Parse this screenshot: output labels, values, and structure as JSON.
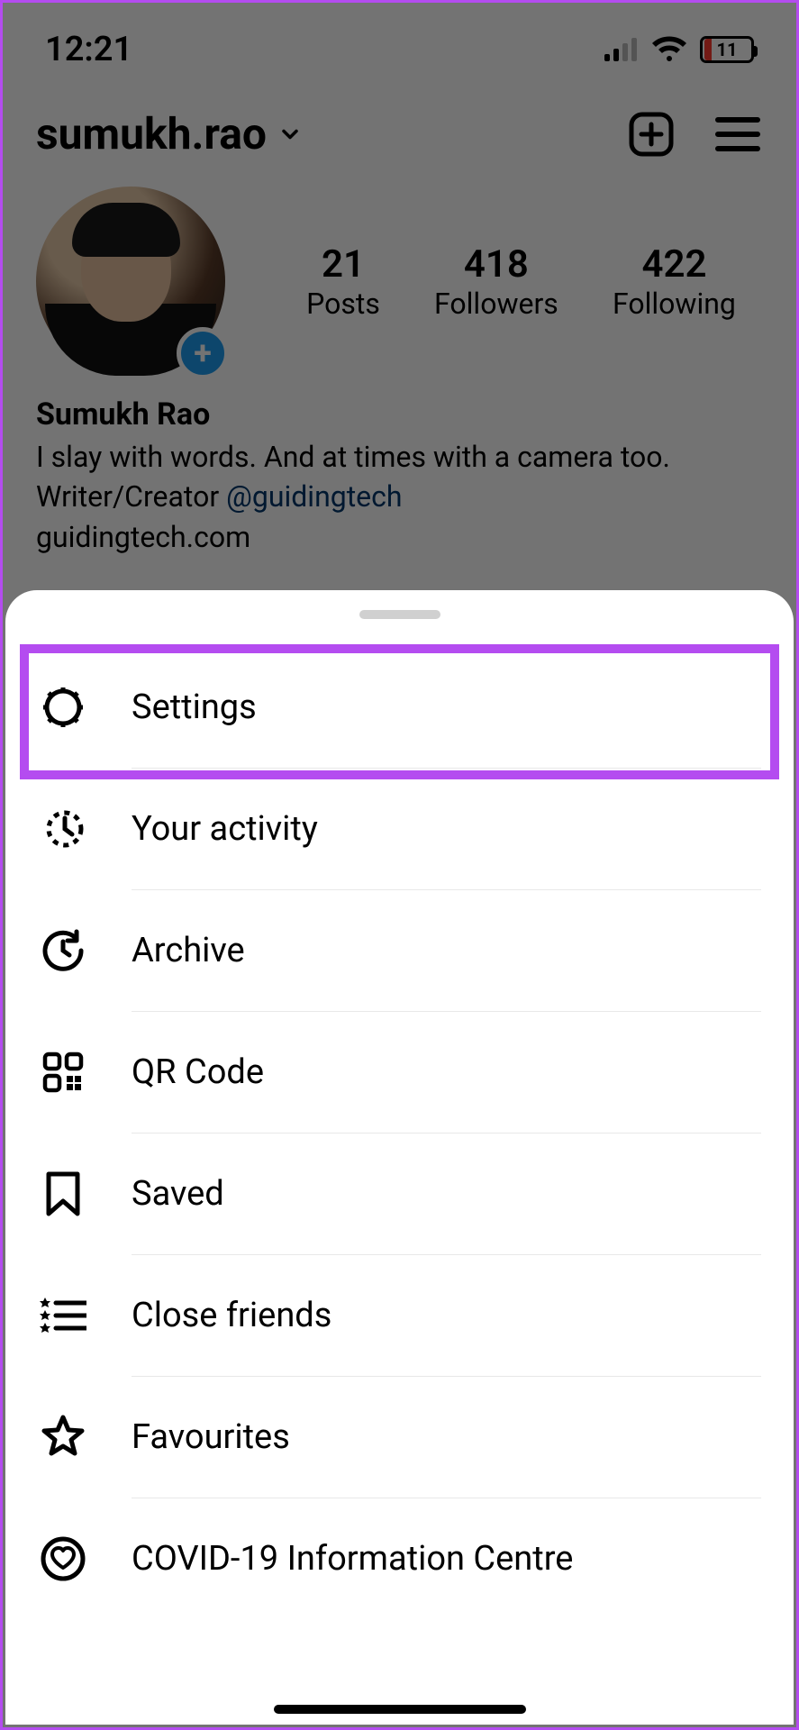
{
  "status": {
    "time": "12:21",
    "battery_pct": "11",
    "battery_low": true
  },
  "profile": {
    "username": "sumukh.rao",
    "display_name": "Sumukh Rao",
    "bio_line1": "I slay with words. And at times with a camera too.",
    "bio_line2_prefix": "Writer/Creator ",
    "bio_line2_handle": "@guidingtech",
    "bio_line3": "guidingtech.com",
    "stats": {
      "posts": {
        "count": "21",
        "label": "Posts"
      },
      "followers": {
        "count": "418",
        "label": "Followers"
      },
      "following": {
        "count": "422",
        "label": "Following"
      }
    }
  },
  "menu": {
    "items": [
      {
        "label": "Settings",
        "icon": "gear-icon"
      },
      {
        "label": "Your activity",
        "icon": "activity-icon"
      },
      {
        "label": "Archive",
        "icon": "archive-icon"
      },
      {
        "label": "QR Code",
        "icon": "qr-code-icon"
      },
      {
        "label": "Saved",
        "icon": "bookmark-icon"
      },
      {
        "label": "Close friends",
        "icon": "close-friends-icon"
      },
      {
        "label": "Favourites",
        "icon": "star-icon"
      },
      {
        "label": "COVID-19 Information Centre",
        "icon": "heart-info-icon"
      }
    ]
  },
  "highlight": {
    "color": "#b44cf0"
  }
}
